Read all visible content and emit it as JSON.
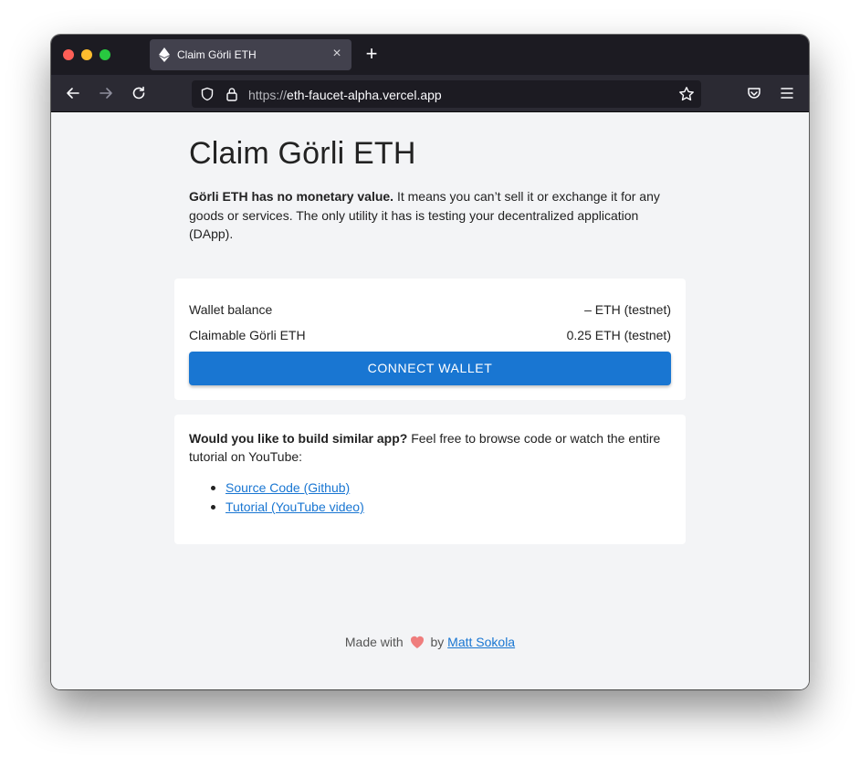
{
  "browser": {
    "tab_title": "Claim Görli ETH",
    "tab_close_icon": "close-icon",
    "new_tab_icon": "plus-icon",
    "url_scheme": "https://",
    "url_host": "eth-faucet-alpha.vercel.app",
    "icons": [
      "back-arrow-icon",
      "forward-arrow-icon",
      "reload-icon",
      "shield-icon",
      "lock-icon",
      "star-icon",
      "pocket-icon",
      "menu-icon"
    ]
  },
  "page": {
    "title": "Claim Görli ETH",
    "intro_bold": "Görli ETH has no monetary value.",
    "intro_rest": " It means you can’t sell it or exchange it for any goods or services. The only utility it has is testing your decentralized application (DApp).",
    "wallet": {
      "balance_label": "Wallet balance",
      "balance_value": "– ETH (testnet)",
      "claimable_label": "Claimable Görli ETH",
      "claimable_value": "0.25 ETH (testnet)",
      "connect_label": "CONNECT WALLET"
    },
    "build": {
      "question": "Would you like to build similar app?",
      "rest": " Feel free to browse code or watch the entire tutorial on YouTube:",
      "links": [
        {
          "label": "Source Code (Github)"
        },
        {
          "label": "Tutorial (YouTube video)"
        }
      ]
    },
    "footer": {
      "made_with": "Made with",
      "by": "by",
      "author": "Matt Sokola"
    }
  },
  "colors": {
    "accent": "#1976d2",
    "page_bg": "#f3f4f6",
    "card_bg": "#ffffff",
    "chrome_dark": "#1c1b22"
  }
}
